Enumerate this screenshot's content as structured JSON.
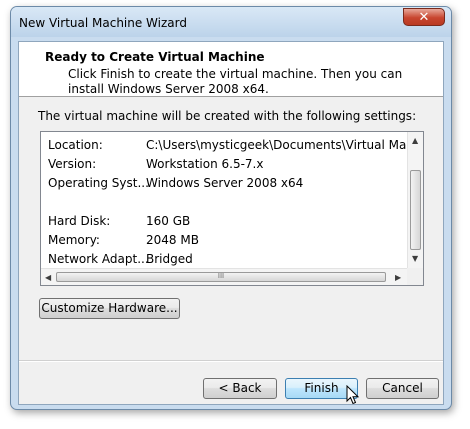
{
  "window": {
    "title": "New Virtual Machine Wizard",
    "close_symbol": "✕"
  },
  "header": {
    "title": "Ready to Create Virtual Machine",
    "description": "Click Finish to create the virtual machine. Then you can install Windows Server 2008 x64."
  },
  "intro": "The virtual machine will be created with the following settings:",
  "settings": [
    {
      "label": "Location:",
      "value": "C:\\Users\\mysticgeek\\Documents\\Virtual Machines\\"
    },
    {
      "label": "Version:",
      "value": "Workstation 6.5-7.x"
    },
    {
      "label": "Operating Syst...",
      "value": "Windows Server 2008 x64"
    },
    {
      "label": "",
      "value": ""
    },
    {
      "label": "Hard Disk:",
      "value": "160 GB"
    },
    {
      "label": "Memory:",
      "value": "2048 MB"
    },
    {
      "label": "Network Adapt...",
      "value": "Bridged"
    }
  ],
  "scrollbars": {
    "up_arrow": "▲",
    "down_arrow": "▼",
    "left_arrow": "◀",
    "right_arrow": "▶",
    "grip": "III"
  },
  "buttons": {
    "customize": "Customize Hardware...",
    "back": "< Back",
    "finish": "Finish",
    "cancel": "Cancel"
  },
  "icons": {
    "cursor": "mouse-pointer-icon"
  }
}
